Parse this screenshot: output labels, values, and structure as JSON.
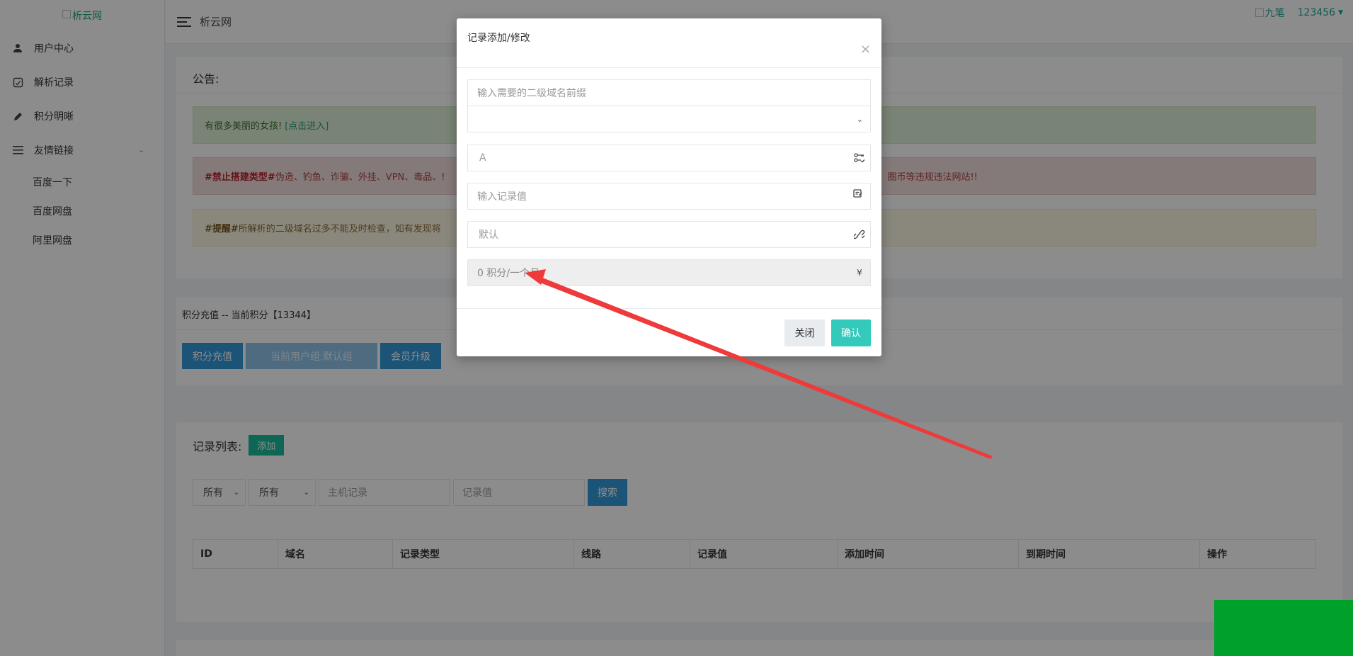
{
  "sidebar": {
    "logo_alt": "析云网",
    "items": [
      {
        "label": "用户中心",
        "icon": "user-icon"
      },
      {
        "label": "解析记录",
        "icon": "records-icon"
      },
      {
        "label": "积分明晰",
        "icon": "pencil-icon"
      },
      {
        "label": "友情链接",
        "icon": "list-icon"
      }
    ],
    "links": [
      "百度一下",
      "百度网盘",
      "阿里网盘"
    ]
  },
  "header": {
    "title": "析云网",
    "user_nick": "九笔",
    "user_name": "123456"
  },
  "notice": {
    "title": "公告:",
    "success_text": "有很多美丽的女孩!",
    "success_link": "[点击进入]",
    "danger_tag": "#禁止搭建类型#",
    "danger_text": " 伪造、钓鱼、诈骗、外挂、VPN、毒品、!",
    "danger_tail": "信息收集、圈币等违规违法网站!!",
    "warning_tag": "#提醒#",
    "warning_text": " 所解析的二级域名过多不能及时检查，如有发现将"
  },
  "points": {
    "title": "积分充值 -- 当前积分【13344】",
    "recharge_label": "积分充值",
    "group_label": "当前用户组:默认组",
    "upgrade_label": "会员升级"
  },
  "records": {
    "title": "记录列表:",
    "add_label": "添加",
    "filter1": "所有",
    "filter2": "所有",
    "host_placeholder": "主机记录",
    "value_placeholder": "记录值",
    "search_label": "搜索",
    "columns": [
      "ID",
      "域名",
      "记录类型",
      "线路",
      "记录值",
      "添加时间",
      "到期时间",
      "操作"
    ]
  },
  "modal": {
    "title": "记录添加/修改",
    "close_symbol": "×",
    "prefix_placeholder": "输入需要的二级域名前缀",
    "domain_select": "",
    "type_value": "A",
    "record_value_placeholder": "输入记录值",
    "line_value": "默认",
    "cost_value": "0 积分/一个月",
    "cost_icon": "¥",
    "close_label": "关闭",
    "confirm_label": "确认"
  }
}
